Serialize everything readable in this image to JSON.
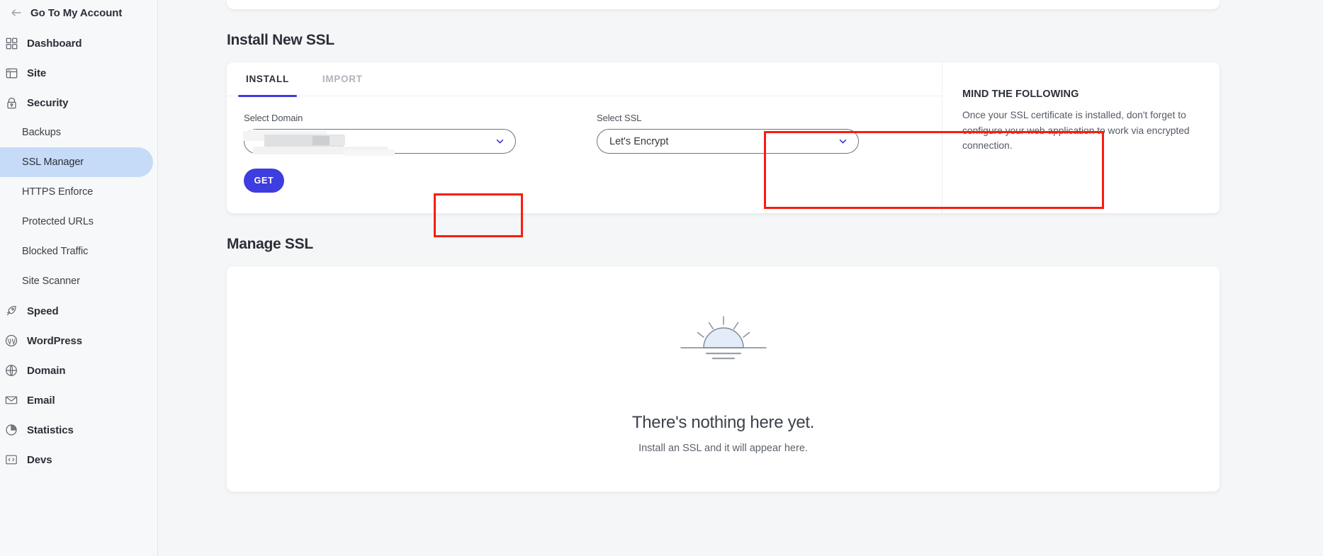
{
  "sidebar": {
    "back_label": "Go To My Account",
    "back_icon": "arrow-left-icon",
    "groups": [
      {
        "label": "Dashboard",
        "icon": "dashboard-grid-icon"
      },
      {
        "label": "Site",
        "icon": "site-layout-icon"
      },
      {
        "label": "Security",
        "icon": "lock-icon"
      }
    ],
    "security_items": [
      {
        "label": "Backups",
        "active": false
      },
      {
        "label": "SSL Manager",
        "active": true
      },
      {
        "label": "HTTPS Enforce",
        "active": false
      },
      {
        "label": "Protected URLs",
        "active": false
      },
      {
        "label": "Blocked Traffic",
        "active": false
      },
      {
        "label": "Site Scanner",
        "active": false
      }
    ],
    "lower_groups": [
      {
        "label": "Speed",
        "icon": "rocket-icon"
      },
      {
        "label": "WordPress",
        "icon": "wordpress-icon"
      },
      {
        "label": "Domain",
        "icon": "globe-icon"
      },
      {
        "label": "Email",
        "icon": "envelope-icon"
      },
      {
        "label": "Statistics",
        "icon": "pie-chart-icon"
      },
      {
        "label": "Devs",
        "icon": "code-brackets-icon"
      }
    ],
    "active_pill_color": "#c6dbf8"
  },
  "main": {
    "install_section_title": "Install New SSL",
    "manage_section_title": "Manage SSL",
    "tabs": [
      {
        "label": "INSTALL",
        "active": true
      },
      {
        "label": "IMPORT",
        "active": false
      }
    ],
    "domain_field": {
      "label": "Select Domain",
      "value": "",
      "redacted": true,
      "chevron_icon": "chevron-down-icon"
    },
    "ssl_field": {
      "label": "Select SSL",
      "value": "Let's Encrypt",
      "chevron_icon": "chevron-down-icon"
    },
    "get_button_label": "GET",
    "info_panel": {
      "title": "MIND THE FOLLOWING",
      "text": "Once your SSL certificate is installed, don't forget to configure your web application to work via encrypted connection."
    },
    "empty_state": {
      "icon": "sunrise-icon",
      "title": "There's nothing here yet.",
      "subtitle": "Install an SSL and it will appear here."
    }
  },
  "annotations": {
    "highlight_color": "#fb1b10",
    "boxes": [
      {
        "name": "select-ssl-highlight"
      },
      {
        "name": "get-button-highlight"
      }
    ]
  },
  "theme": {
    "accent": "#3d3de0",
    "page_bg": "#f5f6f7",
    "sidebar_bg": "#f7f8f9",
    "card_bg": "#ffffff",
    "text_primary": "#2b2f38",
    "text_muted": "#aeb3ba"
  }
}
